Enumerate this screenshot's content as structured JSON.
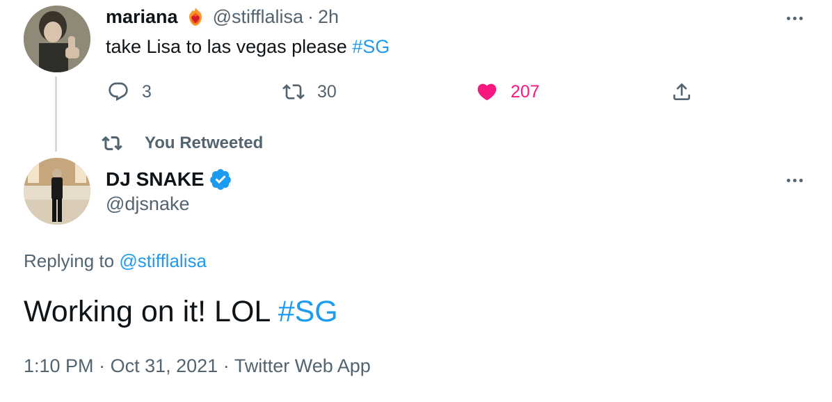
{
  "tweet1": {
    "display_name": "mariana",
    "badge_icon": "flaming-heart-icon",
    "handle": "@stifflalisa",
    "separator": "·",
    "time": "2h",
    "text": "take Lisa to las vegas please",
    "hashtag": "#SG",
    "replies": "3",
    "retweets": "30",
    "likes": "207",
    "liked": true
  },
  "retweet_bar": {
    "label": "You Retweeted"
  },
  "tweet2": {
    "display_name": "DJ SNAKE",
    "verified": true,
    "handle": "@djsnake",
    "replying_prefix": "Replying to",
    "replying_to": "@stifflalisa",
    "text": "Working on it! LOL",
    "hashtag": "#SG",
    "time": "1:10 PM",
    "date": "Oct 31, 2021",
    "source": "Twitter Web App",
    "sep": "·"
  },
  "colors": {
    "accent": "#1d9bf0",
    "like": "#f91880",
    "secondary_text": "#536471",
    "primary_text": "#0f1419"
  }
}
